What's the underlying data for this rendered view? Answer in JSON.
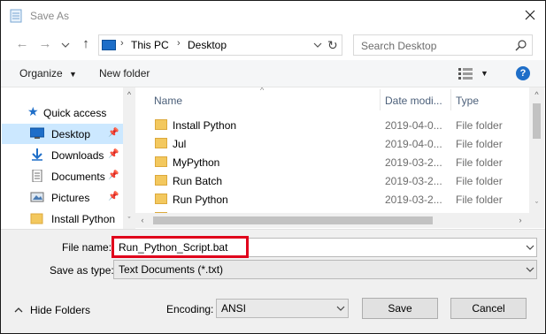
{
  "window": {
    "title": "Save As",
    "close_icon": "close-icon"
  },
  "nav": {
    "back_icon": "back-arrow-icon",
    "forward_icon": "forward-arrow-icon",
    "recent_icon": "chevron-down-icon",
    "up_icon": "up-arrow-icon"
  },
  "address": {
    "crumbs": [
      "This PC",
      "Desktop"
    ],
    "pc_icon": "computer-icon",
    "refresh_icon": "refresh-icon"
  },
  "search": {
    "placeholder": "Search Desktop",
    "icon": "search-icon"
  },
  "toolbar": {
    "organize_label": "Organize",
    "new_folder_label": "New folder",
    "view_icon": "view-options-icon",
    "help_label": "?"
  },
  "sidebar": {
    "items": [
      {
        "label": "Quick access",
        "icon": "star-icon",
        "pinned": false,
        "selected": false
      },
      {
        "label": "Desktop",
        "icon": "desktop-icon",
        "pinned": true,
        "selected": true
      },
      {
        "label": "Downloads",
        "icon": "download-icon",
        "pinned": true,
        "selected": false
      },
      {
        "label": "Documents",
        "icon": "documents-icon",
        "pinned": true,
        "selected": false
      },
      {
        "label": "Pictures",
        "icon": "pictures-icon",
        "pinned": true,
        "selected": false
      },
      {
        "label": "Install Python",
        "icon": "folder-icon",
        "pinned": false,
        "selected": false
      }
    ]
  },
  "files": {
    "columns": [
      "Name",
      "Date modi...",
      "Type"
    ],
    "rows": [
      {
        "name": "Install Python",
        "date": "2019-04-0...",
        "type": "File folder"
      },
      {
        "name": "Jul",
        "date": "2019-04-0...",
        "type": "File folder"
      },
      {
        "name": "MyPython",
        "date": "2019-03-2...",
        "type": "File folder"
      },
      {
        "name": "Run Batch",
        "date": "2019-03-2...",
        "type": "File folder"
      },
      {
        "name": "Run Python",
        "date": "2019-03-2...",
        "type": "File folder"
      }
    ]
  },
  "form": {
    "file_name_label": "File name:",
    "file_name_value": "Run_Python_Script.bat",
    "save_type_label": "Save as type:",
    "save_type_value": "Text Documents (*.txt)",
    "encoding_label": "Encoding:",
    "encoding_value": "ANSI",
    "save_button": "Save",
    "cancel_button": "Cancel",
    "hide_folders": "Hide Folders"
  },
  "colors": {
    "highlight_border": "#e0001b",
    "selection": "#cce8ff",
    "folder": "#f3c85e",
    "accent": "#1e6ec8"
  }
}
